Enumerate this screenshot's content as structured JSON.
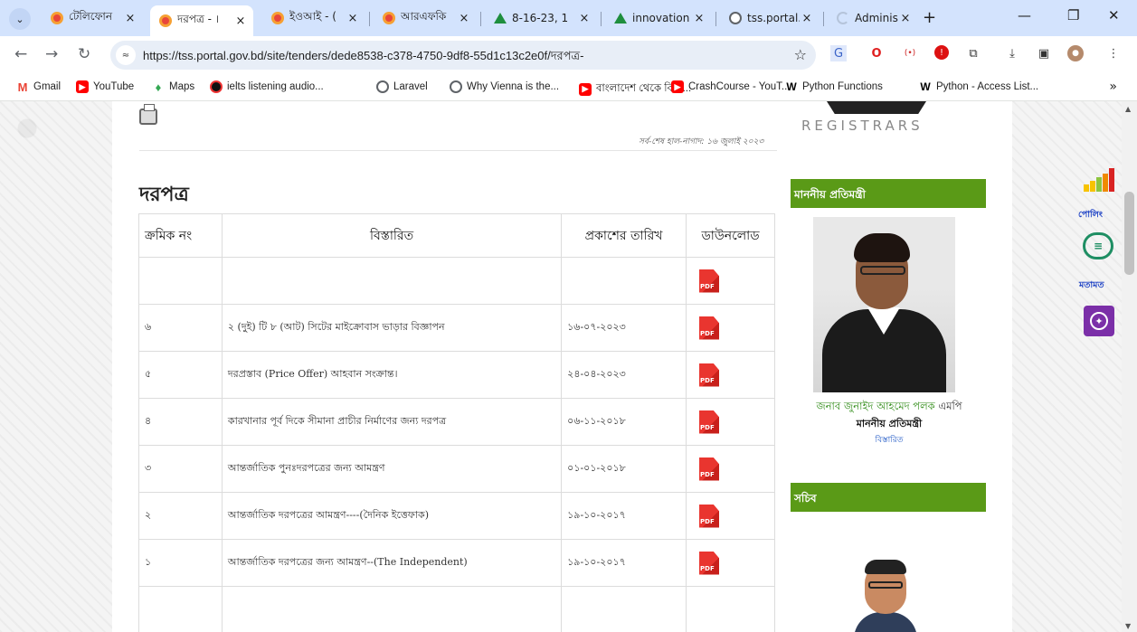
{
  "browser": {
    "tabs": [
      {
        "label": "টেলিফোন",
        "favicon": "opera-icon",
        "active": false
      },
      {
        "label": "দরপত্র - ।",
        "favicon": "opera-icon",
        "active": true
      },
      {
        "label": "ইওআই - (",
        "favicon": "opera-icon",
        "active": false
      },
      {
        "label": "আরএফকি",
        "favicon": "opera-icon",
        "active": false
      },
      {
        "label": "8-16-23, 1",
        "favicon": "google-drive-icon",
        "active": false
      },
      {
        "label": "innovation",
        "favicon": "google-drive-icon",
        "active": false
      },
      {
        "label": "tss.portal.",
        "favicon": "globe-icon",
        "active": false
      },
      {
        "label": "Administra",
        "favicon": "loading-icon",
        "active": false
      }
    ],
    "tab_close": "×",
    "new_tab": "+",
    "tab_menu": "⌄",
    "url": "https://tss.portal.gov.bd/site/tenders/dede8538-c378-4750-9df8-55d1c13c2e0f/দরপত্র-",
    "site_info_icon": "≈",
    "bookmarks": [
      {
        "label": "Gmail",
        "icon": "gmail-icon",
        "glyph": "M"
      },
      {
        "label": "YouTube",
        "icon": "youtube-icon",
        "glyph": "▶"
      },
      {
        "label": "Maps",
        "icon": "maps-icon",
        "glyph": "♦"
      },
      {
        "label": "ielts listening audio...",
        "icon": "record-icon",
        "glyph": ""
      },
      {
        "label": "Laravel",
        "icon": "globe-icon",
        "glyph": ""
      },
      {
        "label": "Why Vienna is the...",
        "icon": "globe-icon",
        "glyph": ""
      },
      {
        "label": "বাংলাদেশ থেকে বিদে...",
        "icon": "youtube-icon",
        "glyph": "▶"
      },
      {
        "label": "CrashCourse - YouT...",
        "icon": "youtube-icon",
        "glyph": "▶"
      },
      {
        "label": "Python Functions",
        "icon": "w3-icon",
        "glyph": "W"
      },
      {
        "label": "Python - Access List...",
        "icon": "w3-icon",
        "glyph": "W"
      }
    ],
    "bookmarks_more": "»"
  },
  "page": {
    "brand": "REGISTRARS",
    "updated": "সর্ব-শেষ হাল-নাগাদ: ১৬ জুলাই ২০২৩",
    "title": "দরপত্র",
    "table": {
      "headers": [
        "ক্রমিক নং",
        "বিস্তারিত",
        "প্রকাশের তারিখ",
        "ডাউনলোড"
      ],
      "pdf_label": "PDF",
      "rows": [
        {
          "sl": "",
          "detail": "",
          "date": "",
          "has_pdf": true
        },
        {
          "sl": "৬",
          "detail": "২ (দুই) টি ৮ (আট) সিটের মাইক্রোবাস ভাড়ার বিজ্ঞাপন",
          "date": "১৬-০৭-২০২৩",
          "has_pdf": true
        },
        {
          "sl": "৫",
          "detail": "দরপ্রস্তাব (Price Offer) আহবান সংক্রান্ত।",
          "date": "২৪-০৪-২০২৩",
          "has_pdf": true
        },
        {
          "sl": "৪",
          "detail": "কারখানার পূর্ব দিকে সীমানা প্রাচীর নির্মাণের জন্য দরপত্র",
          "date": "০৬-১১-২০১৮",
          "has_pdf": true
        },
        {
          "sl": "৩",
          "detail": "আন্তর্জাতিক পুনঃদরপত্রের জন্য আমন্ত্রণ",
          "date": "০১-০১-২০১৮",
          "has_pdf": true
        },
        {
          "sl": "২",
          "detail": "আন্তর্জাতিক দরপত্রের আমন্ত্রণ----(দৈনিক ইত্তেফাক)",
          "date": "১৯-১০-২০১৭",
          "has_pdf": true
        },
        {
          "sl": "১",
          "detail": "আন্তর্জাতিক দরপত্রের জন্য আমন্ত্রণ--(The Independent)",
          "date": "১৯-১০-২০১৭",
          "has_pdf": true
        },
        {
          "sl": "",
          "detail": "",
          "date": "",
          "has_pdf": false
        }
      ]
    },
    "sidebar": {
      "state_minister_heading": "মাননীয় প্রতিমন্ত্রী",
      "minister_name": "জনাব জুনাইদ আহমেদ পলক",
      "minister_suffix": "এমপি",
      "minister_title": "মাননীয় প্রতিমন্ত্রী",
      "details_link": "বিস্তারিত",
      "secretary_heading": "সচিব"
    },
    "widgets": {
      "poll_label": "পোলিং",
      "opinion_label": "মতামত"
    }
  },
  "colors": {
    "sidebar_header": "#5a9a17",
    "minister_name": "#2d8a14",
    "link": "#1a54c4",
    "accessibility": "#7b2fa8"
  }
}
